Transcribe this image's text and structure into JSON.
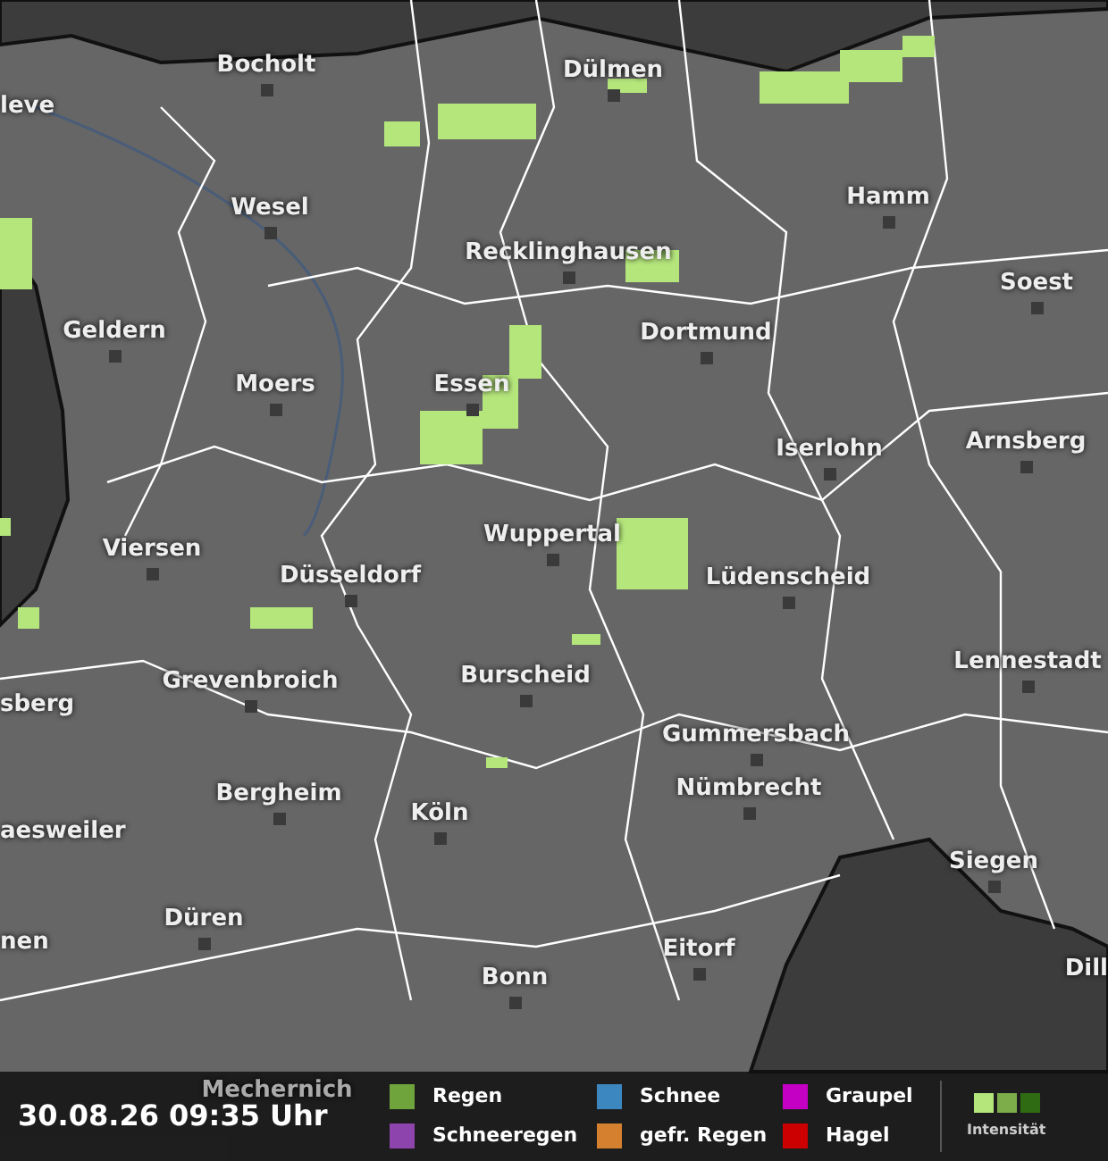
{
  "map": {
    "places": [
      {
        "name": "Bocholt"
      },
      {
        "name": "leve"
      },
      {
        "name": "Dülmen"
      },
      {
        "name": "Wesel"
      },
      {
        "name": "Hamm"
      },
      {
        "name": "Recklinghausen"
      },
      {
        "name": "Soest"
      },
      {
        "name": "Geldern"
      },
      {
        "name": "Dortmund"
      },
      {
        "name": "Moers"
      },
      {
        "name": "Essen"
      },
      {
        "name": "Iserlohn"
      },
      {
        "name": "Arnsberg"
      },
      {
        "name": "Viersen"
      },
      {
        "name": "Düsseldorf"
      },
      {
        "name": "Wuppertal"
      },
      {
        "name": "Lüdenscheid"
      },
      {
        "name": "Lennestadt"
      },
      {
        "name": "Grevenbroich"
      },
      {
        "name": "Burscheid"
      },
      {
        "name": "sberg"
      },
      {
        "name": "Gummersbach"
      },
      {
        "name": "Bergheim"
      },
      {
        "name": "Köln"
      },
      {
        "name": "Nümbrecht"
      },
      {
        "name": "aesweiler"
      },
      {
        "name": "Siegen"
      },
      {
        "name": "Düren"
      },
      {
        "name": "nen"
      },
      {
        "name": "Eitorf"
      },
      {
        "name": "Bonn"
      },
      {
        "name": "Dill"
      },
      {
        "name": "Mechernich"
      }
    ]
  },
  "footer": {
    "timestamp": "30.08.26 09:35 Uhr",
    "legend": [
      {
        "label": "Regen",
        "color": "#6fa33c"
      },
      {
        "label": "Schnee",
        "color": "#3d87c0"
      },
      {
        "label": "Graupel",
        "color": "#c400c4"
      },
      {
        "label": "Schneeregen",
        "color": "#8e44ad"
      },
      {
        "label": "gefr. Regen",
        "color": "#d4802f"
      },
      {
        "label": "Hagel",
        "color": "#cc0000"
      }
    ],
    "intensity": {
      "label": "Intensität",
      "levels": [
        {
          "color": "#b5e67c"
        },
        {
          "color": "#7cad4a"
        },
        {
          "color": "#2e6b12"
        }
      ]
    }
  }
}
